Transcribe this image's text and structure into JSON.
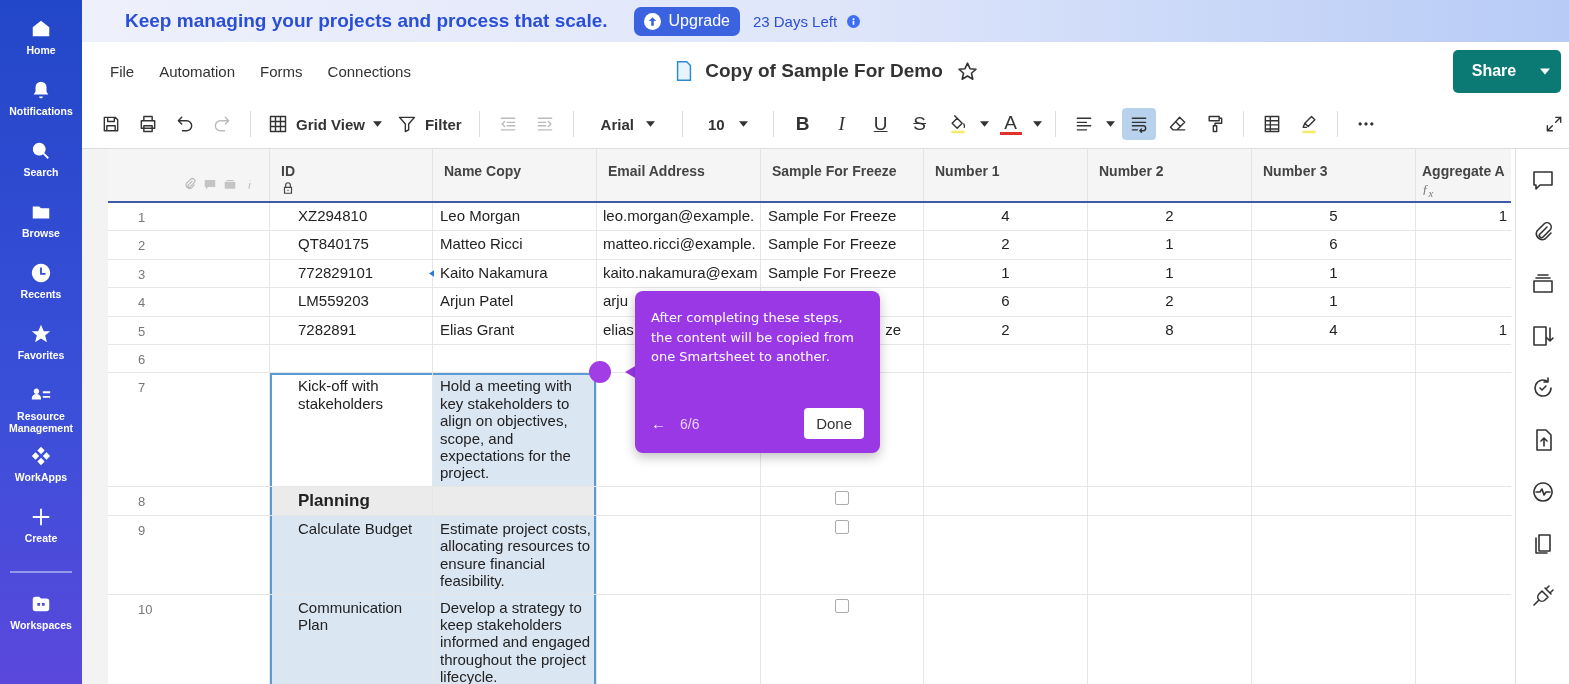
{
  "nav": {
    "items": [
      {
        "label": "Home"
      },
      {
        "label": "Notifications"
      },
      {
        "label": "Search"
      },
      {
        "label": "Browse"
      },
      {
        "label": "Recents"
      },
      {
        "label": "Favorites"
      },
      {
        "label": "Resource Management"
      },
      {
        "label": "WorkApps"
      },
      {
        "label": "Create"
      }
    ],
    "bottom": [
      {
        "label": "Workspaces"
      }
    ]
  },
  "banner": {
    "message": "Keep managing your projects and process that scale.",
    "upgrade": "Upgrade",
    "days_left": "23 Days Left"
  },
  "menu": [
    "File",
    "Automation",
    "Forms",
    "Connections"
  ],
  "sheet": {
    "title": "Copy of Sample For Demo",
    "starred": false
  },
  "share": {
    "label": "Share"
  },
  "toolbar": {
    "redo_enabled": false,
    "indent_enabled": false,
    "view": "Grid View",
    "filter": "Filter",
    "font": "Arial",
    "size": "10",
    "bold": "B",
    "italic": "I",
    "underline": "U",
    "strike": "S",
    "text_color": "A",
    "wrap_on": true
  },
  "grid": {
    "columns": [
      {
        "label": "ID",
        "locked": true
      },
      {
        "label": "Name Copy"
      },
      {
        "label": "Email Address"
      },
      {
        "label": "Sample For Freeze"
      },
      {
        "label": "Number 1"
      },
      {
        "label": "Number 2"
      },
      {
        "label": "Number 3"
      },
      {
        "label": "Aggregate A",
        "formula": "ƒ$_{x}$"
      }
    ],
    "rows": [
      {
        "num": "1",
        "kind": "data",
        "id": "XZ294810",
        "name": "Leo Morgan",
        "email": "leo.morgan@example.",
        "sample": "Sample For Freeze",
        "n1": "4",
        "n2": "2",
        "n3": "5",
        "agg": "1"
      },
      {
        "num": "2",
        "kind": "data",
        "id": "QT840175",
        "name": "Matteo Ricci",
        "email": "matteo.ricci@example.",
        "sample": "Sample For Freeze",
        "n1": "2",
        "n2": "1",
        "n3": "6"
      },
      {
        "num": "3",
        "kind": "data",
        "id": "772829101",
        "name": "Kaito Nakamura",
        "marker": true,
        "email": "kaito.nakamura@exam",
        "sample": "Sample For Freeze",
        "n1": "1",
        "n2": "1",
        "n3": "1"
      },
      {
        "num": "4",
        "kind": "data",
        "id": "LM559203",
        "name": "Arjun Patel",
        "email": "arju",
        "n1": "6",
        "n2": "2",
        "n3": "1"
      },
      {
        "num": "5",
        "kind": "data",
        "id": "7282891",
        "name": "Elias Grant",
        "email": "elias",
        "sample": "ze",
        "sample_tail": true,
        "n1": "2",
        "n2": "8",
        "n3": "4",
        "agg": "1"
      },
      {
        "num": "6",
        "kind": "data"
      },
      {
        "num": "7",
        "kind": "task",
        "id": "Kick-off with stakeholders",
        "name": "Hold a meeting with key stakeholders to align on objectives, scope, and expectations for the project.",
        "selected": true,
        "active": true
      },
      {
        "num": "8",
        "kind": "section",
        "id": "Planning",
        "selected": true,
        "checked": false
      },
      {
        "num": "9",
        "kind": "task",
        "id": "Calculate Budget",
        "name": "Estimate project costs, allocating resources to ensure financial feasibility.",
        "selected": true,
        "checked": false
      },
      {
        "num": "10",
        "kind": "task",
        "id": "Communication Plan",
        "name": "Develop a strategy to keep stakeholders informed and engaged throughout the project lifecycle.",
        "selected": true,
        "checked": false
      }
    ]
  },
  "tour": {
    "text": "After completing these steps, the content will be copied from one Smartsheet to another.",
    "back": "←",
    "step": "6/6",
    "done": "Done"
  }
}
